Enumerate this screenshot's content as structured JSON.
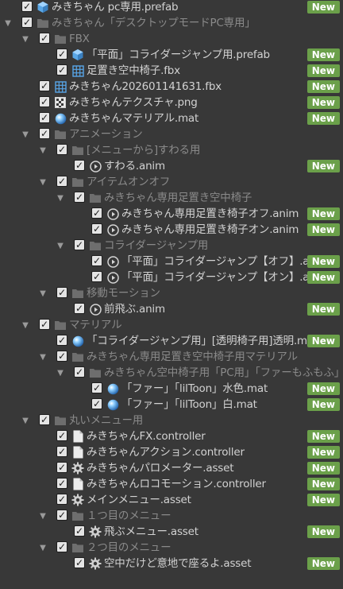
{
  "badge_label": "New",
  "rows": [
    {
      "depth": 0,
      "arrow": false,
      "dim": false,
      "icon": "prefab-icon",
      "label": "みきちゃん pc専用.prefab",
      "badge": true
    },
    {
      "depth": 0,
      "arrow": true,
      "dim": true,
      "icon": "folder-icon",
      "label": "みきちゃん「デスクトップモードPC専用」",
      "badge": false
    },
    {
      "depth": 1,
      "arrow": true,
      "dim": true,
      "icon": "folder-icon",
      "label": "FBX",
      "badge": false
    },
    {
      "depth": 2,
      "arrow": false,
      "dim": false,
      "icon": "prefab-icon",
      "label": "「平面」コライダージャンプ用.prefab",
      "badge": true
    },
    {
      "depth": 2,
      "arrow": false,
      "dim": false,
      "icon": "mesh-icon",
      "label": "足置き空中椅子.fbx",
      "badge": true
    },
    {
      "depth": 1,
      "arrow": false,
      "dim": false,
      "icon": "mesh-icon",
      "label": "みきちゃん202601141631.fbx",
      "badge": true
    },
    {
      "depth": 1,
      "arrow": false,
      "dim": false,
      "icon": "texture-icon",
      "label": "みきちゃんテクスチャ.png",
      "badge": true
    },
    {
      "depth": 1,
      "arrow": false,
      "dim": false,
      "icon": "material-icon",
      "label": "みきちゃんマテリアル.mat",
      "badge": true
    },
    {
      "depth": 1,
      "arrow": true,
      "dim": true,
      "icon": "folder-icon",
      "label": "アニメーション",
      "badge": false
    },
    {
      "depth": 2,
      "arrow": true,
      "dim": true,
      "icon": "folder-icon",
      "label": "[メニューから]すわる用",
      "badge": false
    },
    {
      "depth": 3,
      "arrow": false,
      "dim": false,
      "icon": "animation-icon",
      "label": "すわる.anim",
      "badge": true
    },
    {
      "depth": 2,
      "arrow": true,
      "dim": true,
      "icon": "folder-icon",
      "label": "アイテムオンオフ",
      "badge": false
    },
    {
      "depth": 3,
      "arrow": true,
      "dim": true,
      "icon": "folder-icon",
      "label": "みきちゃん専用足置き空中椅子",
      "badge": false
    },
    {
      "depth": 4,
      "arrow": false,
      "dim": false,
      "icon": "animation-icon",
      "label": "みきちゃん専用足置き椅子オフ.anim",
      "badge": true
    },
    {
      "depth": 4,
      "arrow": false,
      "dim": false,
      "icon": "animation-icon",
      "label": "みきちゃん専用足置き椅子オン.anim",
      "badge": true
    },
    {
      "depth": 3,
      "arrow": true,
      "dim": true,
      "icon": "folder-icon",
      "label": "コライダージャンプ用",
      "badge": false
    },
    {
      "depth": 4,
      "arrow": false,
      "dim": false,
      "icon": "animation-icon",
      "label": "「平面」コライダージャンプ【オフ】.anim",
      "badge": true
    },
    {
      "depth": 4,
      "arrow": false,
      "dim": false,
      "icon": "animation-icon",
      "label": "「平面」コライダージャンプ【オン】.anim",
      "badge": true
    },
    {
      "depth": 2,
      "arrow": true,
      "dim": true,
      "icon": "folder-icon",
      "label": "移動モーション",
      "badge": false
    },
    {
      "depth": 3,
      "arrow": false,
      "dim": false,
      "icon": "animation-icon",
      "label": "前飛ぶ.anim",
      "badge": true
    },
    {
      "depth": 1,
      "arrow": true,
      "dim": true,
      "icon": "folder-icon",
      "label": "マテリアル",
      "badge": false
    },
    {
      "depth": 2,
      "arrow": false,
      "dim": false,
      "icon": "material-icon",
      "label": "「コライダージャンプ用」[透明椅子用]透明.mat",
      "badge": true
    },
    {
      "depth": 2,
      "arrow": true,
      "dim": true,
      "icon": "folder-icon",
      "label": "みきちゃん専用足置き空中椅子用マテリアル",
      "badge": false
    },
    {
      "depth": 3,
      "arrow": true,
      "dim": true,
      "icon": "folder-icon",
      "label": "みきちゃん空中椅子用「PC用」「ファーもふもふ」",
      "badge": false
    },
    {
      "depth": 4,
      "arrow": false,
      "dim": false,
      "icon": "material-icon",
      "label": "「ファー」「lilToon」水色.mat",
      "badge": true
    },
    {
      "depth": 4,
      "arrow": false,
      "dim": false,
      "icon": "material-icon",
      "label": "「ファー」「lilToon」白.mat",
      "badge": true
    },
    {
      "depth": 1,
      "arrow": true,
      "dim": true,
      "icon": "folder-icon",
      "label": "丸いメニュー用",
      "badge": false
    },
    {
      "depth": 2,
      "arrow": false,
      "dim": false,
      "icon": "document-icon",
      "label": "みきちゃんFX.controller",
      "badge": true
    },
    {
      "depth": 2,
      "arrow": false,
      "dim": false,
      "icon": "document-icon",
      "label": "みきちゃんアクション.controller",
      "badge": true
    },
    {
      "depth": 2,
      "arrow": false,
      "dim": false,
      "icon": "gear-icon",
      "label": "みきちゃんパロメーター.asset",
      "badge": true
    },
    {
      "depth": 2,
      "arrow": false,
      "dim": false,
      "icon": "document-icon",
      "label": "みきちゃんロコモーション.controller",
      "badge": true
    },
    {
      "depth": 2,
      "arrow": false,
      "dim": false,
      "icon": "gear-icon",
      "label": "メインメニュー.asset",
      "badge": true
    },
    {
      "depth": 2,
      "arrow": true,
      "dim": true,
      "icon": "folder-icon",
      "label": "１つ目のメニュー",
      "badge": false
    },
    {
      "depth": 3,
      "arrow": false,
      "dim": false,
      "icon": "gear-icon",
      "label": "飛ぶメニュー.asset",
      "badge": true
    },
    {
      "depth": 2,
      "arrow": true,
      "dim": true,
      "icon": "folder-icon",
      "label": "２つ目のメニュー",
      "badge": false
    },
    {
      "depth": 3,
      "arrow": false,
      "dim": false,
      "icon": "gear-icon",
      "label": "空中だけど意地で座るよ.asset",
      "badge": true
    }
  ]
}
